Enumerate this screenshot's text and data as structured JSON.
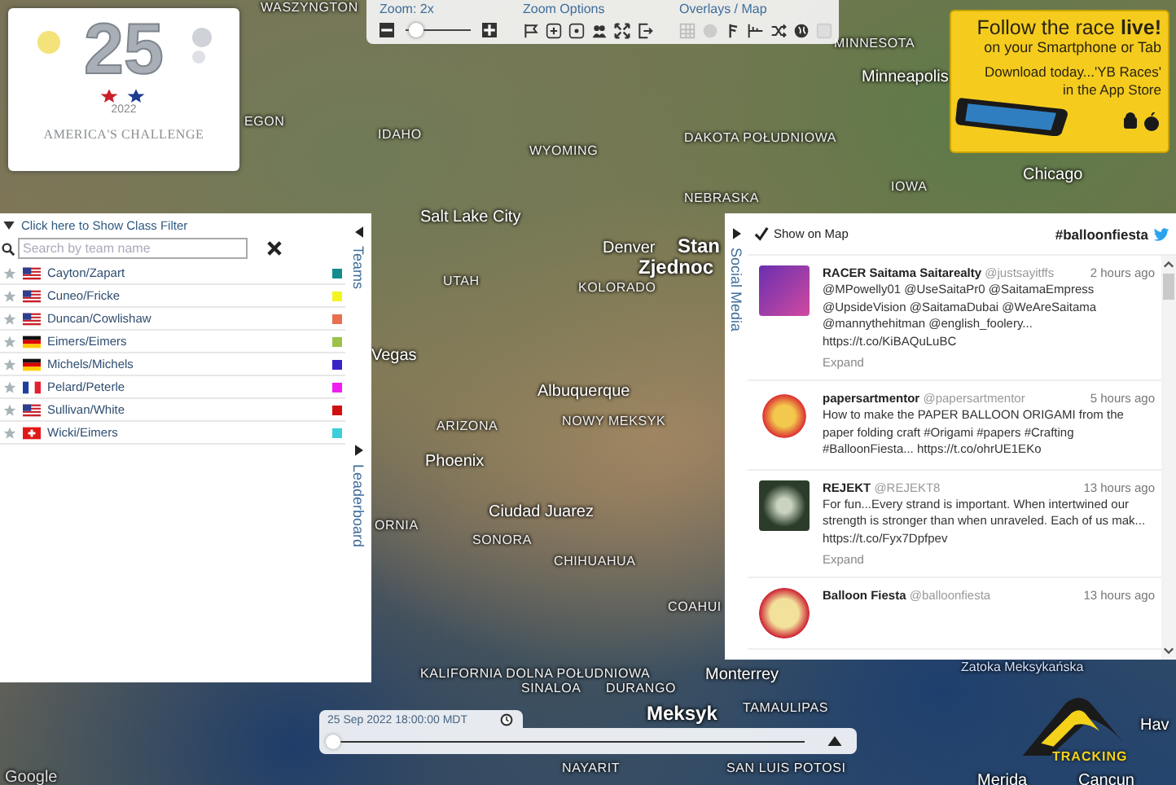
{
  "logo": {
    "number": "25",
    "year": "2022",
    "name": "AMERICA'S CHALLENGE"
  },
  "toolbar": {
    "zoom": {
      "label": "Zoom: 2x",
      "level": 0.05
    },
    "zoom_options": {
      "label": "Zoom Options"
    },
    "overlays": {
      "label": "Overlays / Map"
    }
  },
  "ad": {
    "headline": "Follow the race **live!**",
    "subline": "on your Smartphone or Tab",
    "download": "Download today...'YB Races'",
    "store": "in the App Store"
  },
  "map_labels": [
    {
      "text": "WASZYNGTON",
      "kind": "region"
    },
    {
      "text": "EGON",
      "kind": "region"
    },
    {
      "text": "IDAHO",
      "kind": "region"
    },
    {
      "text": "WYOMING",
      "kind": "region"
    },
    {
      "text": "MINNESOTA",
      "kind": "region"
    },
    {
      "text": "Minneapolis",
      "kind": "city"
    },
    {
      "text": "DAKOTA POŁUDNIOWA",
      "kind": "region"
    },
    {
      "text": "NEBRASKA",
      "kind": "region"
    },
    {
      "text": "IOWA",
      "kind": "region"
    },
    {
      "text": "Chicago",
      "kind": "city"
    },
    {
      "text": "Salt Lake City",
      "kind": "city"
    },
    {
      "text": "UTAH",
      "kind": "region"
    },
    {
      "text": "Denver",
      "kind": "city"
    },
    {
      "text": "KOLORADO",
      "kind": "region"
    },
    {
      "text": "Stan",
      "kind": "country"
    },
    {
      "text": "Zjednoc",
      "kind": "country"
    },
    {
      "text": "Vegas",
      "kind": "city"
    },
    {
      "text": "ARIZONA",
      "kind": "region"
    },
    {
      "text": "Albuquerque",
      "kind": "city"
    },
    {
      "text": "NOWY MEKSYK",
      "kind": "region"
    },
    {
      "text": "Phoenix",
      "kind": "city"
    },
    {
      "text": "Ciudad Juarez",
      "kind": "city"
    },
    {
      "text": "SONORA",
      "kind": "region"
    },
    {
      "text": "CHIHUAHUA",
      "kind": "region"
    },
    {
      "text": "COAHUI",
      "kind": "region"
    },
    {
      "text": "ORNIA",
      "kind": "region"
    },
    {
      "text": "KALIFORNIA DOLNA POŁUDNIOWA",
      "kind": "region"
    },
    {
      "text": "SINALOA",
      "kind": "region"
    },
    {
      "text": "DURANGO",
      "kind": "region"
    },
    {
      "text": "Monterrey",
      "kind": "city"
    },
    {
      "text": "Meksyk",
      "kind": "country"
    },
    {
      "text": "TAMAULIPAS",
      "kind": "region"
    },
    {
      "text": "NAYARIT",
      "kind": "region"
    },
    {
      "text": "SAN LUIS POTOSI",
      "kind": "region"
    },
    {
      "text": "Zatoka Meksykańska",
      "kind": "water"
    },
    {
      "text": "Merida",
      "kind": "city"
    },
    {
      "text": "Cancun",
      "kind": "city"
    },
    {
      "text": "Hav",
      "kind": "city"
    },
    {
      "text": "Google",
      "kind": "credit"
    }
  ],
  "teams_panel": {
    "filter_toggle": "Click here to Show Class Filter",
    "search": {
      "placeholder": "Search by team name"
    },
    "tab": "Teams",
    "leaderboard_tab": "Leaderboard",
    "teams": [
      {
        "name": "Cayton/Zapart",
        "kind": "us",
        "color": "#148c8c"
      },
      {
        "name": "Cuneo/Fricke",
        "kind": "us",
        "color": "#f4f41e"
      },
      {
        "name": "Duncan/Cowlishaw",
        "kind": "us",
        "color": "#e8704f"
      },
      {
        "name": "Eimers/Eimers",
        "kind": "de",
        "color": "#9cc24a"
      },
      {
        "name": "Michels/Michels",
        "kind": "de",
        "color": "#3a24c8"
      },
      {
        "name": "Pelard/Peterle",
        "kind": "fr",
        "color": "#f01ef0"
      },
      {
        "name": "Sullivan/White",
        "kind": "us",
        "color": "#d01010"
      },
      {
        "name": "Wicki/Eimers",
        "kind": "ch",
        "color": "#3ccfd8"
      }
    ]
  },
  "social_panel": {
    "tab": "Social Media",
    "show_on_map": {
      "label": "Show on Map",
      "checked": true
    },
    "hashtag": "#balloonfiesta",
    "tweets": [
      {
        "name": "RACER Saitama Saitarealty",
        "handle": "@justsayitffs",
        "time": "2 hours ago",
        "text": "@MPowelly01 @UseSaitaPr0 @SaitamaEmpress @UpsideVision @SaitamaDubai @WeAreSaitama @mannythehitman @english_foolery... https://t.co/KiBAQuLuBC",
        "expand": "Expand"
      },
      {
        "name": "papersartmentor",
        "handle": "@papersartmentor",
        "time": "5 hours ago",
        "text": "How to make the PAPER BALLOON ORIGAMI from the paper folding craft #Origami #papers #Crafting #BalloonFiesta... https://t.co/ohrUE1EKo"
      },
      {
        "name": "REJEKT",
        "handle": "@REJEKT8",
        "time": "13 hours ago",
        "text": "For fun...Every strand is important. When intertwined our strength is stronger than when unraveled. Each of us mak... https://t.co/Fyx7Dpfpev",
        "expand": "Expand"
      },
      {
        "name": "Balloon Fiesta",
        "handle": "@balloonfiesta",
        "time": "13 hours ago"
      }
    ]
  },
  "timeline": {
    "time": "25 Sep 2022 18:00:00 MDT",
    "level": 0.0
  },
  "tracking_logo": {
    "text": "TRACKING"
  }
}
